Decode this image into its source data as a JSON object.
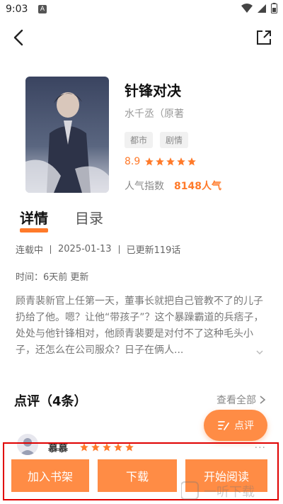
{
  "status": {
    "time": "9:03",
    "sim_badge": "A"
  },
  "book": {
    "title": "针锋对决",
    "author": "水千丞（原著",
    "tags": [
      "都市",
      "剧情"
    ],
    "score": "8.9",
    "popularity_label": "人气指数",
    "popularity_value": "8148人气"
  },
  "tabs": {
    "details": "详情",
    "toc": "目录"
  },
  "meta": {
    "status": "连载中",
    "date": "2025-01-13",
    "updated": "已更新119话",
    "time_text": "时间：6天前 更新"
  },
  "description": "顾青裴新官上任第一天，董事长就把自己管教不了的儿子扔给了他。嗯？让他“带孩子”？这个暴躁霸道的兵痞子，处处与他针锋相对，他顾青裴要是对付不了这种毛头小子，还怎么在公司服众？日子在俩人...",
  "reviews": {
    "title": "点评（4条）",
    "see_all": "查看全部",
    "review_button": "点评",
    "first_reviewer": "慕慕",
    "more": "..."
  },
  "bottom": {
    "add_shelf": "加入书架",
    "download": "下载",
    "start_read": "开始阅读"
  },
  "watermark_text": "一听下载",
  "colors": {
    "accent": "#ff8c45",
    "accent_text": "#ff7a2a",
    "highlight_frame": "#e00000"
  }
}
